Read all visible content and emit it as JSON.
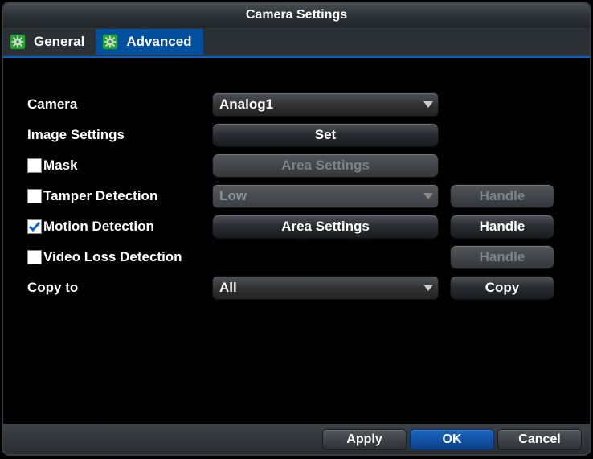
{
  "window": {
    "title": "Camera Settings"
  },
  "tabs": {
    "general": "General",
    "advanced": "Advanced",
    "active": "advanced"
  },
  "rows": {
    "camera": {
      "label": "Camera",
      "value": "Analog1"
    },
    "image_settings": {
      "label": "Image Settings",
      "button": "Set"
    },
    "mask": {
      "label": "Mask",
      "checked": false,
      "button": "Area Settings"
    },
    "tamper": {
      "label": "Tamper Detection",
      "checked": false,
      "value": "Low",
      "handle": "Handle"
    },
    "motion": {
      "label": "Motion Detection",
      "checked": true,
      "button": "Area Settings",
      "handle": "Handle"
    },
    "videoloss": {
      "label": "Video Loss Detection",
      "checked": false,
      "handle": "Handle"
    },
    "copy": {
      "label": "Copy to",
      "value": "All",
      "button": "Copy"
    }
  },
  "footer": {
    "apply": "Apply",
    "ok": "OK",
    "cancel": "Cancel"
  }
}
